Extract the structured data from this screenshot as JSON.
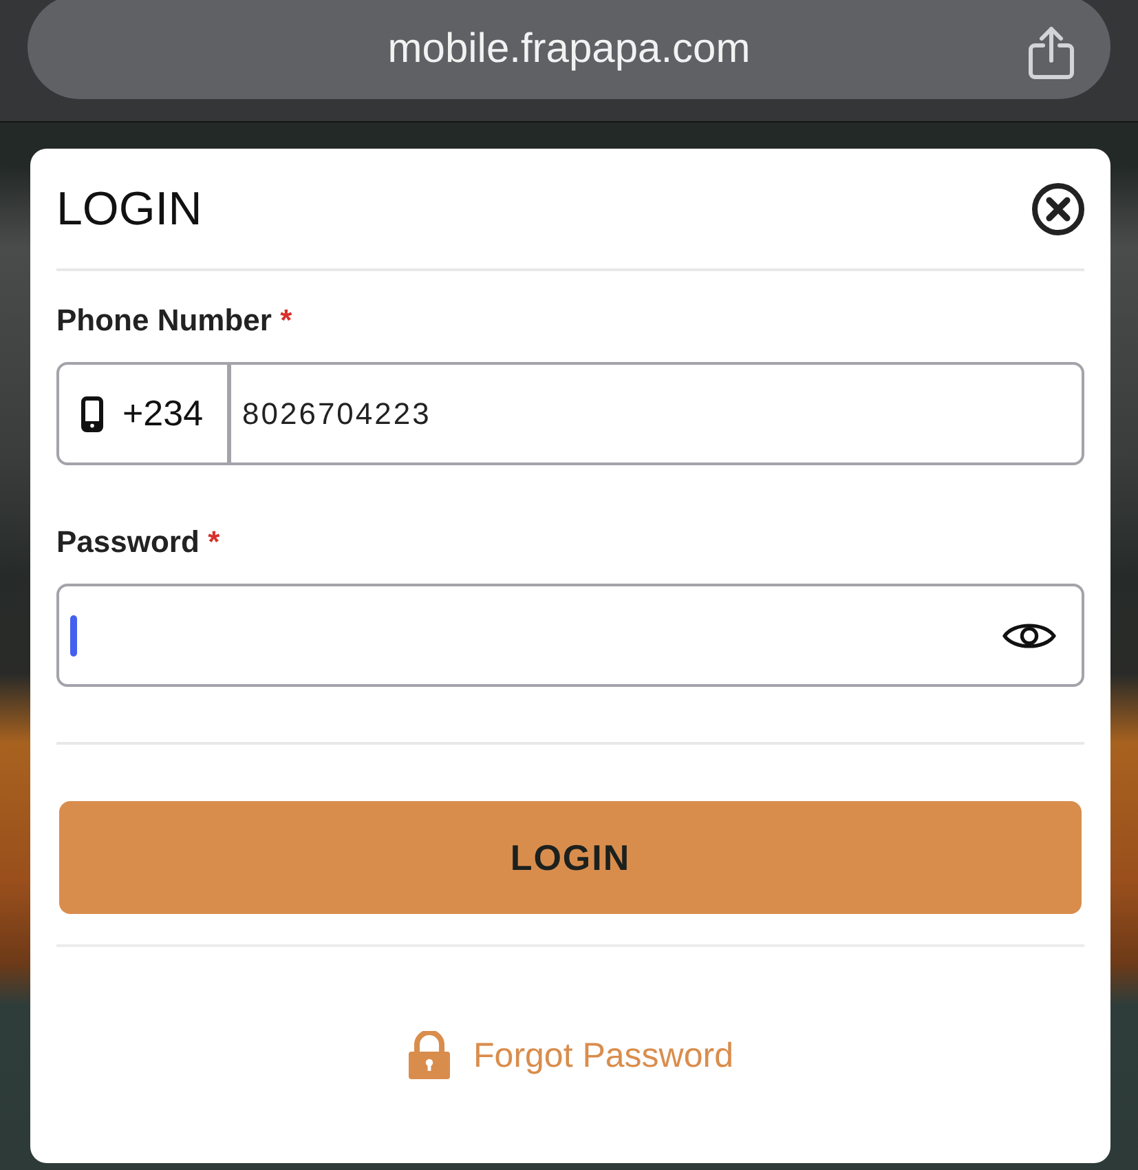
{
  "browser": {
    "url": "mobile.frapapa.com"
  },
  "modal": {
    "title": "LOGIN",
    "fields": [
      {
        "kind": "phone",
        "label": "Phone Number",
        "required_mark": "*",
        "prefix": "+234",
        "value": "8026704223"
      },
      {
        "kind": "password",
        "label": "Password",
        "required_mark": "*",
        "focused": true
      }
    ],
    "submit_button": "LOGIN",
    "forgot_link": "Forgot Password"
  }
}
